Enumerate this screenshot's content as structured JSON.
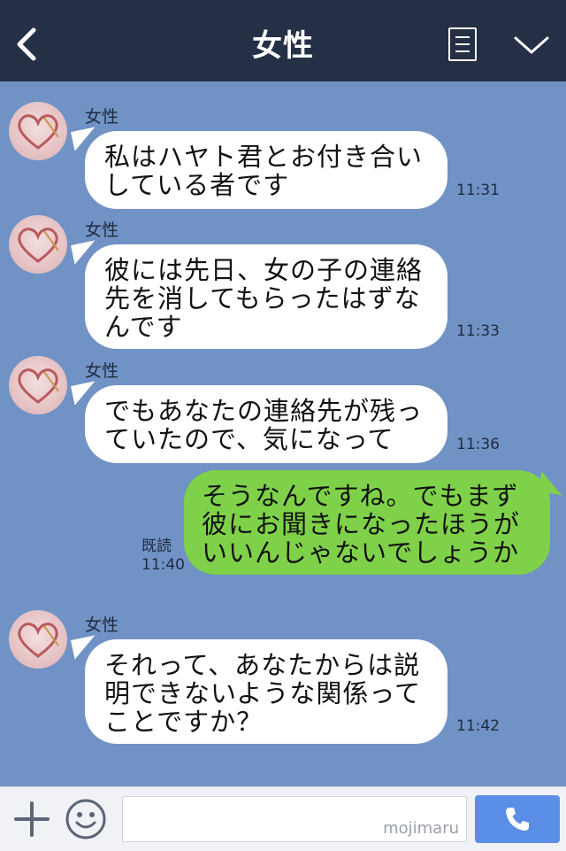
{
  "header": {
    "title": "女性"
  },
  "messages": [
    {
      "direction": "incoming",
      "sender": "女性",
      "lines": [
        "私はハヤト君とお付き合い",
        "している者です"
      ],
      "time": "11:31"
    },
    {
      "direction": "incoming",
      "sender": "女性",
      "lines": [
        "彼には先日、女の子の連絡",
        "先を消してもらったはずな",
        "んです"
      ],
      "time": "11:33"
    },
    {
      "direction": "incoming",
      "sender": "女性",
      "lines": [
        "でもあなたの連絡先が残っ",
        "ていたので、気になって"
      ],
      "time": "11:36"
    },
    {
      "direction": "outgoing",
      "read_label": "既読",
      "lines": [
        "そうなんですね。でもまず",
        "彼にお聞きになったほうが",
        "いいんじゃないでしょうか"
      ],
      "time": "11:40"
    },
    {
      "direction": "incoming",
      "sender": "女性",
      "lines": [
        "それって、あなたからは説",
        "明できないような関係って",
        "ことですか？"
      ],
      "time": "11:42"
    }
  ],
  "footer": {
    "input_value": "",
    "watermark": "mojimaru",
    "icons": [
      "plus-icon",
      "smiley-icon",
      "phone-icon"
    ]
  },
  "colors": {
    "header_bg": "#252f45",
    "chat_bg": "#7192c4",
    "incoming_bubble": "#ffffff",
    "outgoing_bubble": "#7fd149",
    "call_button": "#5b8ee6"
  }
}
